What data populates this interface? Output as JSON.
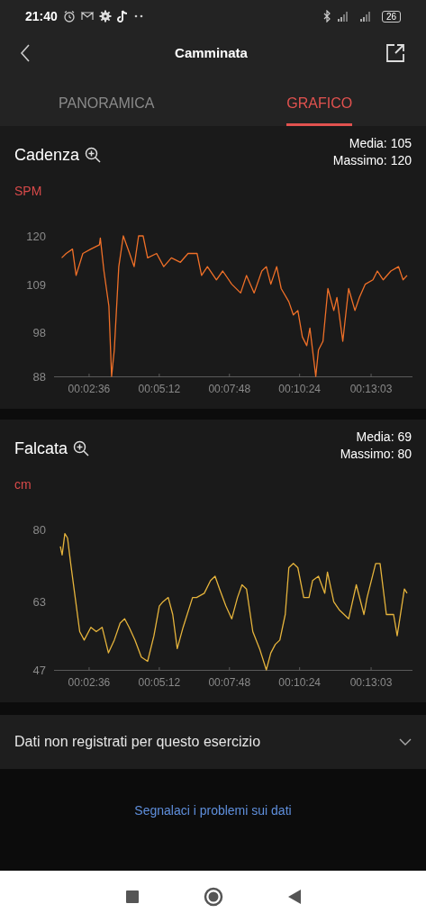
{
  "status_bar": {
    "time": "21:40",
    "battery": "26"
  },
  "header": {
    "title": "Camminata"
  },
  "tabs": [
    {
      "label": "PANORAMICA",
      "selected": false
    },
    {
      "label": "GRAFICO",
      "selected": true
    }
  ],
  "charts": [
    {
      "title": "Cadenza",
      "average": "Media: 105",
      "maximum": "Massimo: 120",
      "unit": "SPM",
      "chart_data": {
        "type": "line",
        "xlim": [
          78,
          875
        ],
        "ylim": [
          88,
          120
        ],
        "yticks": [
          88,
          98,
          109,
          120
        ],
        "xticks": [
          {
            "value": 156,
            "label": "00:02:36"
          },
          {
            "value": 312,
            "label": "00:05:12"
          },
          {
            "value": 468,
            "label": "00:07:48"
          },
          {
            "value": 624,
            "label": "00:10:24"
          },
          {
            "value": 783,
            "label": "00:13:03"
          }
        ],
        "x": [
          95,
          105,
          119,
          127,
          142,
          160,
          179,
          181,
          189,
          200,
          206,
          212,
          222,
          232,
          246,
          256,
          266,
          276,
          286,
          306,
          322,
          339,
          359,
          376,
          396,
          406,
          419,
          439,
          453,
          473,
          493,
          506,
          523,
          540,
          550,
          560,
          573,
          583,
          600,
          610,
          620,
          630,
          640,
          647,
          660,
          666,
          676,
          687,
          700,
          707,
          720,
          733,
          747,
          757,
          770,
          787,
          797,
          810,
          827,
          844,
          854,
          863
        ],
        "series": [
          {
            "color": "#f07028",
            "values": [
              115,
              116,
              117,
              111,
              116,
              117,
              118,
              119.5,
              112,
              104,
              88,
              94,
              113,
              120,
              116,
              113,
              120,
              120,
              115,
              116,
              113,
              115,
              114,
              116,
              116,
              111,
              113,
              110,
              112,
              109,
              107,
              111,
              107,
              112,
              113,
              109,
              113,
              108,
              105,
              102,
              103,
              97,
              95,
              99,
              88,
              94,
              96,
              108,
              103,
              106,
              96,
              108,
              103,
              106,
              109,
              110,
              112,
              110,
              112,
              113,
              110,
              111
            ]
          }
        ]
      }
    },
    {
      "title": "Falcata",
      "average": "Media: 69",
      "maximum": "Massimo: 80",
      "unit": "cm",
      "chart_data": {
        "type": "line",
        "xlim": [
          78,
          875
        ],
        "ylim": [
          47,
          80
        ],
        "yticks": [
          47,
          63,
          80
        ],
        "xticks": [
          {
            "value": 156,
            "label": "00:02:36"
          },
          {
            "value": 312,
            "label": "00:05:12"
          },
          {
            "value": 468,
            "label": "00:07:48"
          },
          {
            "value": 624,
            "label": "00:10:24"
          },
          {
            "value": 783,
            "label": "00:13:03"
          }
        ],
        "x": [
          92,
          96,
          102,
          108,
          115,
          125,
          135,
          145,
          160,
          172,
          185,
          199,
          212,
          225,
          235,
          245,
          258,
          272,
          286,
          300,
          312,
          320,
          332,
          342,
          352,
          365,
          386,
          395,
          412,
          426,
          436,
          446,
          460,
          473,
          486,
          496,
          506,
          520,
          535,
          550,
          560,
          570,
          580,
          592,
          600,
          610,
          620,
          633,
          645,
          653,
          666,
          680,
          686,
          700,
          713,
          733,
          750,
          767,
          774,
          793,
          803,
          817,
          833,
          841,
          857,
          863
        ],
        "series": [
          {
            "color": "#e6b43c",
            "values": [
              76,
              74,
              79,
              78,
              72,
              64,
              56,
              54,
              57,
              56,
              57,
              51,
              54,
              58,
              59,
              57,
              54,
              50,
              49,
              55,
              62,
              63,
              64,
              60,
              52,
              57,
              64,
              64,
              65,
              68,
              69,
              66,
              62,
              59,
              64,
              67,
              66,
              56,
              52,
              47,
              51,
              53,
              54,
              60,
              71,
              72,
              71,
              64,
              64,
              68,
              69,
              65,
              70,
              63,
              61,
              59,
              67,
              60,
              64,
              72,
              72,
              60,
              60,
              55,
              66,
              65
            ]
          }
        ]
      }
    }
  ],
  "info_row": {
    "label": "Dati non registrati per questo esercizio",
    "expanded": false
  },
  "report_link": "Segnalaci i problemi sui dati"
}
